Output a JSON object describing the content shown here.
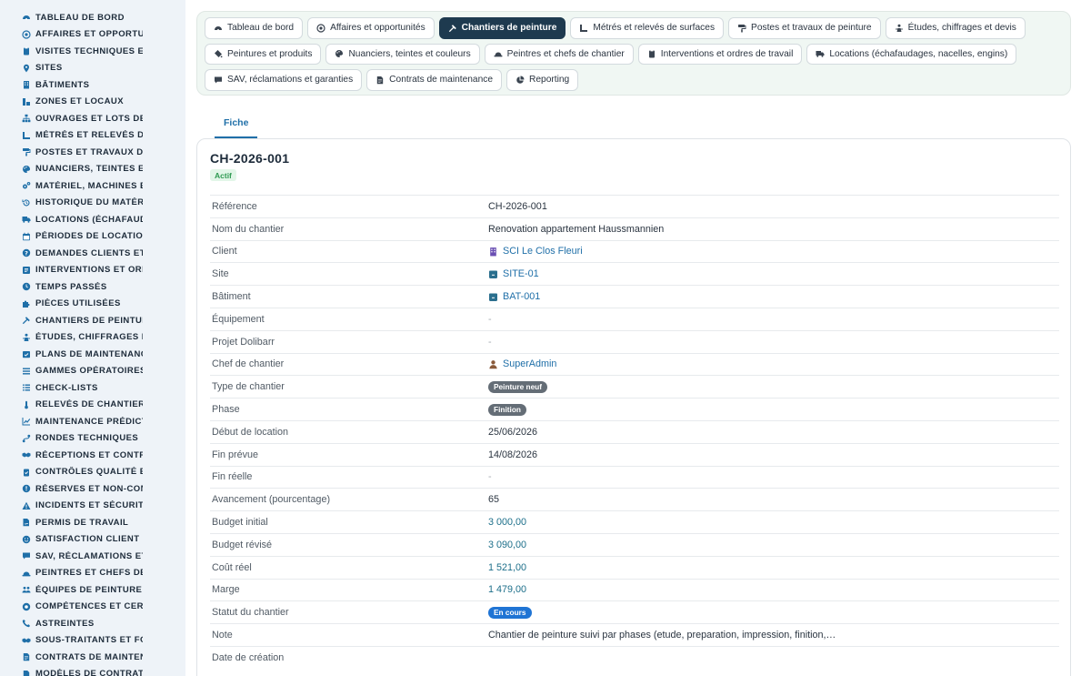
{
  "sidebar": {
    "items": [
      {
        "label": "TABLEAU DE BORD",
        "icon": "dashboard-icon",
        "color": "#1f6fa8"
      },
      {
        "label": "AFFAIRES ET OPPORTUNITÉS",
        "icon": "target-icon",
        "color": "#1f6fa8"
      },
      {
        "label": "VISITES TECHNIQUES ET RELEVÉS",
        "icon": "clipboard-icon",
        "color": "#1f6fa8"
      },
      {
        "label": "SITES",
        "icon": "map-pin-icon",
        "color": "#1f6fa8"
      },
      {
        "label": "BÂTIMENTS",
        "icon": "building-icon",
        "color": "#1f6fa8"
      },
      {
        "label": "ZONES ET LOCAUX",
        "icon": "layers-icon",
        "color": "#1f6fa8"
      },
      {
        "label": "OUVRAGES ET LOTS DE TRAVAUX",
        "icon": "sitemap-icon",
        "color": "#1f6fa8"
      },
      {
        "label": "MÉTRÉS ET RELEVÉS DE SURFACES",
        "icon": "ruler-icon",
        "color": "#1f6fa8"
      },
      {
        "label": "POSTES ET TRAVAUX DE PEINTURE",
        "icon": "paint-roller-icon",
        "color": "#1f6fa8"
      },
      {
        "label": "NUANCIERS, TEINTES ET COULEURS",
        "icon": "palette-icon",
        "color": "#1f6fa8"
      },
      {
        "label": "MATÉRIEL, MACHINES ET OUTILS",
        "icon": "gears-icon",
        "color": "#1f6fa8"
      },
      {
        "label": "HISTORIQUE DU MATÉRIEL",
        "icon": "history-icon",
        "color": "#1f6fa8"
      },
      {
        "label": "LOCATIONS (ÉCHAFAUDAGES)",
        "icon": "truck-icon",
        "color": "#1f6fa8"
      },
      {
        "label": "PÉRIODES DE LOCATION",
        "icon": "calendar-icon",
        "color": "#1f6fa8"
      },
      {
        "label": "DEMANDES CLIENTS ET INTERVENTIONS",
        "icon": "question-icon",
        "color": "#1f6fa8"
      },
      {
        "label": "INTERVENTIONS ET ORDRES DE TRAVAIL",
        "icon": "wrench-icon",
        "color": "#1f6fa8"
      },
      {
        "label": "TEMPS PASSÉS",
        "icon": "clock-icon",
        "color": "#1f6fa8"
      },
      {
        "label": "PIÈCES UTILISÉES",
        "icon": "puzzle-icon",
        "color": "#1f6fa8"
      },
      {
        "label": "CHANTIERS DE PEINTURE",
        "icon": "hammer-icon",
        "color": "#1f6fa8"
      },
      {
        "label": "ÉTUDES, CHIFFRAGES ET DEVIS",
        "icon": "people-icon",
        "color": "#1f6fa8"
      },
      {
        "label": "PLANS DE MAINTENANCE",
        "icon": "calendar-check-icon",
        "color": "#1f6fa8"
      },
      {
        "label": "GAMMES OPÉRATOIRES",
        "icon": "list-icon",
        "color": "#1f6fa8"
      },
      {
        "label": "CHECK-LISTS",
        "icon": "checklist-icon",
        "color": "#1f6fa8"
      },
      {
        "label": "RELEVÉS DE CHANTIER",
        "icon": "thermometer-icon",
        "color": "#1f6fa8"
      },
      {
        "label": "MAINTENANCE PRÉDICTIVE",
        "icon": "chart-line-icon",
        "color": "#1f6fa8"
      },
      {
        "label": "RONDES TECHNIQUES",
        "icon": "route-icon",
        "color": "#1f6fa8"
      },
      {
        "label": "RÉCEPTIONS ET CONTRÔLES",
        "icon": "handshake-icon",
        "color": "#1f6fa8"
      },
      {
        "label": "CONTRÔLES QUALITÉ ET AUDITS",
        "icon": "clipboard-check-icon",
        "color": "#1f6fa8"
      },
      {
        "label": "RÉSERVES ET NON-CONFORMITÉS",
        "icon": "alert-circle-icon",
        "color": "#1f6fa8"
      },
      {
        "label": "INCIDENTS ET SÉCURITÉ",
        "icon": "warning-icon",
        "color": "#1f6fa8"
      },
      {
        "label": "PERMIS DE TRAVAIL",
        "icon": "file-signature-icon",
        "color": "#1f6fa8"
      },
      {
        "label": "SATISFACTION CLIENT",
        "icon": "smile-icon",
        "color": "#1f6fa8"
      },
      {
        "label": "SAV, RÉCLAMATIONS ET GARANTIES",
        "icon": "comments-icon",
        "color": "#1f6fa8"
      },
      {
        "label": "PEINTRES ET CHEFS DE CHANTIER",
        "icon": "hard-hat-icon",
        "color": "#1f6fa8"
      },
      {
        "label": "ÉQUIPES DE PEINTURE",
        "icon": "users-icon",
        "color": "#1f6fa8"
      },
      {
        "label": "COMPÉTENCES ET CERTIFICATIONS",
        "icon": "certificate-icon",
        "color": "#1f6fa8"
      },
      {
        "label": "ASTREINTES",
        "icon": "phone-icon",
        "color": "#1f6fa8"
      },
      {
        "label": "SOUS-TRAITANTS ET FOURNISSEURS",
        "icon": "handshake-icon",
        "color": "#1f6fa8"
      },
      {
        "label": "CONTRATS DE MAINTENANCE",
        "icon": "file-contract-icon",
        "color": "#1f6fa8"
      },
      {
        "label": "MODÈLES DE CONTRATS",
        "icon": "file-icon",
        "color": "#1f6fa8"
      }
    ]
  },
  "topnav": {
    "items": [
      {
        "label": "Tableau de bord",
        "icon": "dashboard-icon",
        "active": false
      },
      {
        "label": "Affaires et opportunités",
        "icon": "target-icon",
        "active": false
      },
      {
        "label": "Chantiers de peinture",
        "icon": "hammer-icon",
        "active": true
      },
      {
        "label": "Métrés et relevés de surfaces",
        "icon": "ruler-icon",
        "active": false
      },
      {
        "label": "Postes et travaux de peinture",
        "icon": "paint-roller-icon",
        "active": false
      },
      {
        "label": "Études, chiffrages et devis",
        "icon": "people-icon",
        "active": false
      },
      {
        "label": "Peintures et produits",
        "icon": "paint-bucket-icon",
        "active": false
      },
      {
        "label": "Nuanciers, teintes et couleurs",
        "icon": "palette-icon",
        "active": false
      },
      {
        "label": "Peintres et chefs de chantier",
        "icon": "hard-hat-icon",
        "active": false
      },
      {
        "label": "Interventions et ordres de travail",
        "icon": "clipboard-icon",
        "active": false
      },
      {
        "label": "Locations (échafaudages, nacelles, engins)",
        "icon": "truck-icon",
        "active": false
      },
      {
        "label": "SAV, réclamations et garanties",
        "icon": "comments-icon",
        "active": false
      },
      {
        "label": "Contrats de maintenance",
        "icon": "file-contract-icon",
        "active": false
      },
      {
        "label": "Reporting",
        "icon": "pie-chart-icon",
        "active": false
      }
    ]
  },
  "tabs": [
    {
      "label": "Fiche"
    }
  ],
  "record": {
    "title": "CH-2026-001",
    "status_badge": "Actif",
    "fields": [
      {
        "key": "Référence",
        "value": "CH-2026-001",
        "kind": "text"
      },
      {
        "key": "Nom du chantier",
        "value": "Renovation appartement Haussmannien",
        "kind": "text"
      },
      {
        "key": "Client",
        "value": "SCI Le Clos Fleuri",
        "kind": "link",
        "icon": "building-icon"
      },
      {
        "key": "Site",
        "value": "SITE-01",
        "kind": "link",
        "icon": "box-icon"
      },
      {
        "key": "Bâtiment",
        "value": "BAT-001",
        "kind": "link",
        "icon": "box-icon"
      },
      {
        "key": "Équipement",
        "value": "-",
        "kind": "dash"
      },
      {
        "key": "Projet Dolibarr",
        "value": "-",
        "kind": "dash"
      },
      {
        "key": "Chef de chantier",
        "value": "SuperAdmin",
        "kind": "link",
        "icon": "user-icon"
      },
      {
        "key": "Type de chantier",
        "value": "Peinture neuf",
        "kind": "tag-grey"
      },
      {
        "key": "Phase",
        "value": "Finition",
        "kind": "tag-grey"
      },
      {
        "key": "Début de location",
        "value": "25/06/2026",
        "kind": "text"
      },
      {
        "key": "Fin prévue",
        "value": "14/08/2026",
        "kind": "text"
      },
      {
        "key": "Fin réelle",
        "value": "-",
        "kind": "dash"
      },
      {
        "key": "Avancement (pourcentage)",
        "value": "65",
        "kind": "text"
      },
      {
        "key": "Budget initial",
        "value": "3 000,00",
        "kind": "money"
      },
      {
        "key": "Budget révisé",
        "value": "3 090,00",
        "kind": "money"
      },
      {
        "key": "Coût réel",
        "value": "1 521,00",
        "kind": "money"
      },
      {
        "key": "Marge",
        "value": "1 479,00",
        "kind": "money"
      },
      {
        "key": "Statut du chantier",
        "value": "En cours",
        "kind": "tag-blue"
      },
      {
        "key": "Note",
        "value": "Chantier de peinture suivi par phases (etude, preparation, impression, finition,…",
        "kind": "text"
      },
      {
        "key": "Date de création",
        "value": "",
        "kind": "text"
      }
    ]
  }
}
